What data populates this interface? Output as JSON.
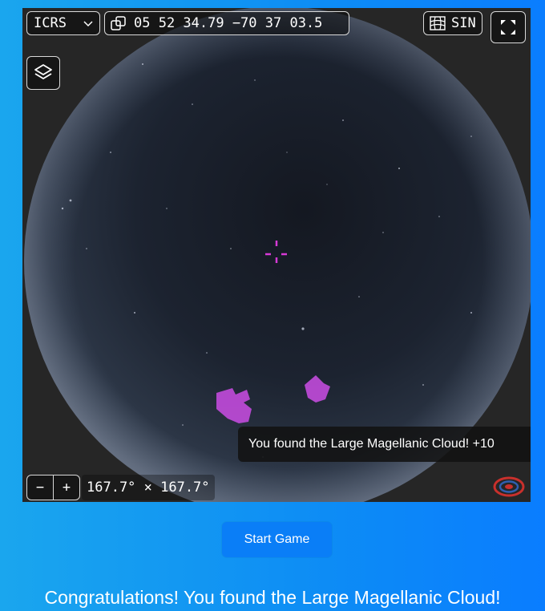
{
  "viewer": {
    "frame": "ICRS",
    "coordinates": "05 52 34.79 −70 37 03.5",
    "projection": "SIN",
    "fov": "167.7° × 167.7°",
    "zoom_out_label": "−",
    "zoom_in_label": "+",
    "toast": "You found the Large Magellanic Cloud! +10"
  },
  "icons": {
    "frame_dropdown": "chevron-down-icon",
    "copy": "copy-icon",
    "projection": "grid-icon",
    "fullscreen": "expand-icon",
    "layers": "layers-icon",
    "crosshair": "crosshair-icon",
    "logo": "aladin-logo-icon"
  },
  "colors": {
    "page_gradient_start": "#1aa6ee",
    "page_gradient_end": "#0a7dff",
    "button": "#0a7ef7",
    "crosshair": "#d63ad6",
    "highlight": "#c24bdc"
  },
  "controls": {
    "start_button": "Start Game"
  },
  "message": "Congratulations! You found the Large Magellanic Cloud!"
}
